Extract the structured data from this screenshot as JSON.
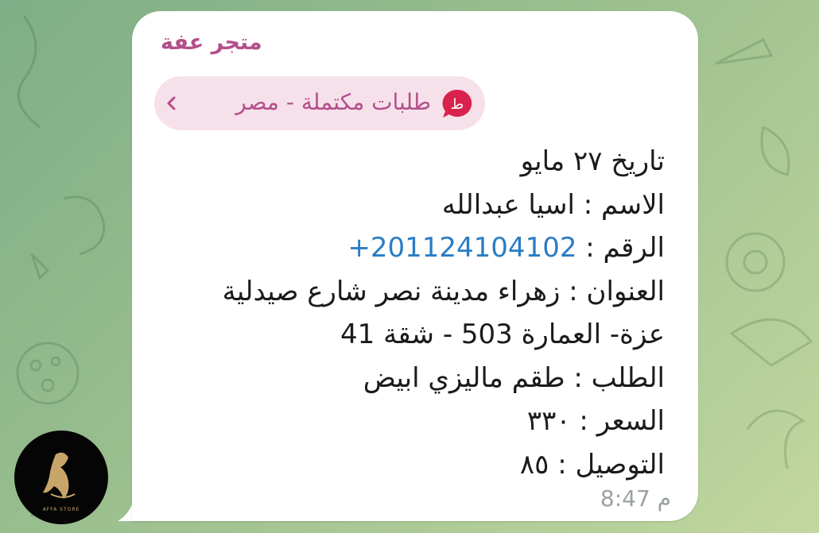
{
  "message": {
    "sender_name": "متجر عفة",
    "topic": {
      "label": "طلبات مكتملة - مصر",
      "badge_letter": "ط",
      "badge_color": "#d8224c"
    },
    "lines": [
      "تاريخ ٢٧ مايو",
      "الاسم :  اسيا عبدالله",
      "العنوان : زهراء مدينة نصر شارع صيدلية",
      "عزة- العمارة 503 - شقة 41",
      "الطلب : طقم ماليزي ابيض",
      "السعر : ٣٣٠",
      "التوصيل : ٨٥"
    ],
    "phone": {
      "label": "الرقم : ",
      "number": "+201124104102"
    },
    "time": "8:47 م"
  },
  "avatar": {
    "logo_text": "عفة",
    "caption": "AFFA STORE"
  },
  "colors": {
    "sender": "#b44f8b",
    "link": "#2a7dc3",
    "bubble": "#ffffff"
  }
}
